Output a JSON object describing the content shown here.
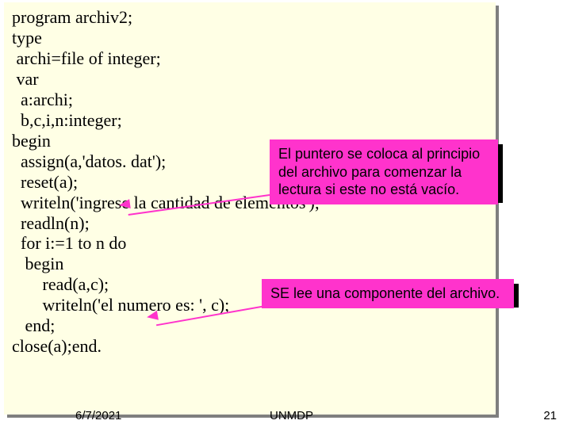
{
  "code": {
    "l1": "program archiv2;",
    "l2": "type",
    "l3": " archi=file of integer;",
    "l4": " var",
    "l5": "  a:archi;",
    "l6": "  b,c,i,n:integer;",
    "l7": "begin",
    "l8": "  assign(a,'datos. dat');",
    "l9": "  reset(a);",
    "l10": "  writeln('ingrese la cantidad de elementos');",
    "l11": "  readln(n);",
    "l12": "  for i:=1 to n do",
    "l13": "   begin",
    "l14": "       read(a,c);",
    "l15": "       writeln('el numero es: ', c);",
    "l16": "   end;",
    "l17": "close(a);end."
  },
  "callouts": {
    "c1": "El puntero  se coloca  al principio del archivo para comenzar la lectura si este no está vacío.",
    "c2": "SE lee una componente del archivo."
  },
  "footer": {
    "date": "6/7/2021",
    "center": "UNMDP",
    "page": "21"
  }
}
